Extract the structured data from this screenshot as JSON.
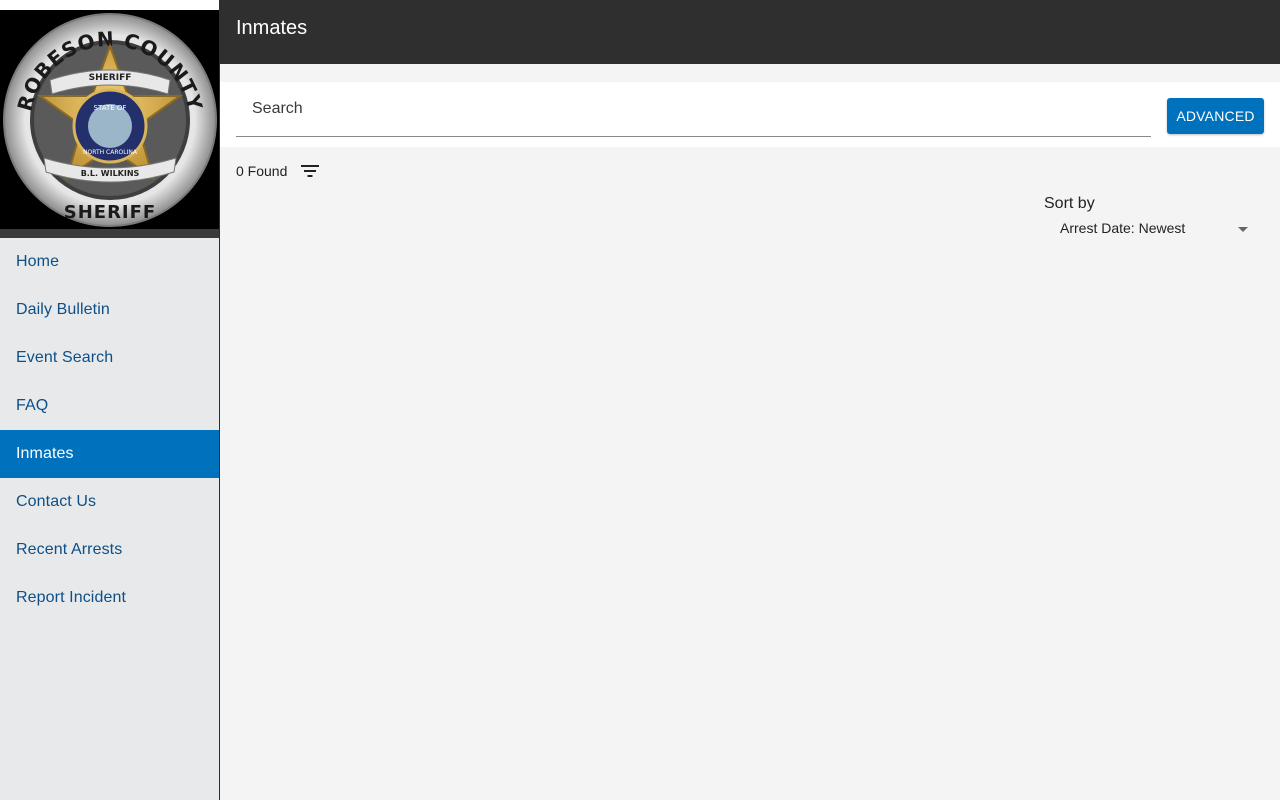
{
  "sidebar": {
    "logo": {
      "top_text": "ROBESON COUNTY",
      "bottom_text": "SHERIFF",
      "ribbon_top": "SHERIFF",
      "ribbon_bottom": "B.L. WILKINS",
      "seal_top": "STATE OF",
      "seal_bottom": "NORTH CAROLINA"
    },
    "items": [
      {
        "label": "Home"
      },
      {
        "label": "Daily Bulletin"
      },
      {
        "label": "Event Search"
      },
      {
        "label": "FAQ"
      },
      {
        "label": "Inmates",
        "active": true
      },
      {
        "label": "Contact Us"
      },
      {
        "label": "Recent Arrests"
      },
      {
        "label": "Report Incident"
      }
    ]
  },
  "header": {
    "title": "Inmates"
  },
  "search": {
    "placeholder": "Search",
    "advanced_label": "ADVANCED"
  },
  "results": {
    "found_text": "0 Found"
  },
  "sort": {
    "label": "Sort by",
    "selected": "Arrest Date: Newest"
  },
  "colors": {
    "accent": "#0071bc",
    "topbar": "#2f2f2f",
    "nav_text": "#0d4f86"
  },
  "icons": {
    "filter": "filter-list-icon",
    "dropdown": "arrow-drop-down-icon"
  }
}
